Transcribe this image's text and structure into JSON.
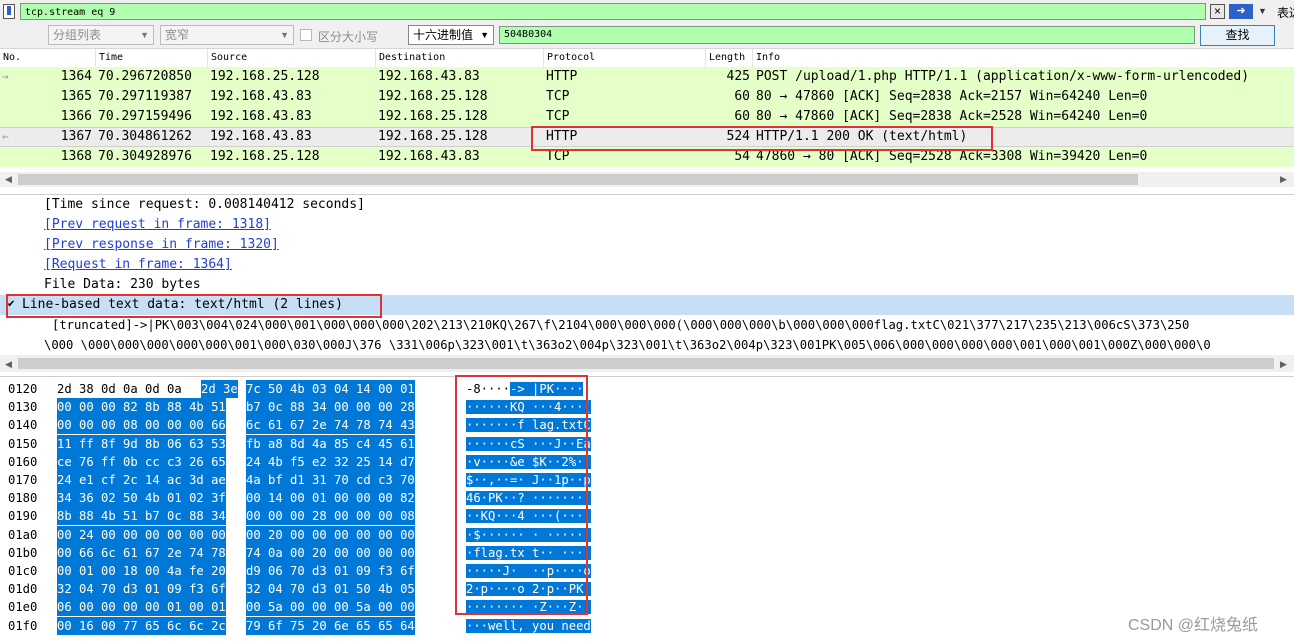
{
  "filter": {
    "value": "tcp.stream eq 9",
    "expression_label": "表达",
    "clear_icon": "x",
    "apply_icon": "arrow-right"
  },
  "find": {
    "display_combo": "分组列表",
    "charset_combo": "宽窄",
    "case_label": "区分大小写",
    "type_combo": "十六进制值",
    "search_value": "504B0304",
    "find_button": "查找"
  },
  "packet_list": {
    "columns": [
      "No.",
      "Time",
      "Source",
      "Destination",
      "Protocol",
      "Length",
      "Info"
    ],
    "rows": [
      {
        "no": "1364",
        "time": "70.296720850",
        "src": "192.168.25.128",
        "dst": "192.168.43.83",
        "proto": "HTTP",
        "len": "425",
        "info": "POST /upload/1.php HTTP/1.1  (application/x-www-form-urlencoded)",
        "rel": "→"
      },
      {
        "no": "1365",
        "time": "70.297119387",
        "src": "192.168.43.83",
        "dst": "192.168.25.128",
        "proto": "TCP",
        "len": "60",
        "info": "80 → 47860 [ACK] Seq=2838 Ack=2157 Win=64240 Len=0",
        "rel": ""
      },
      {
        "no": "1366",
        "time": "70.297159496",
        "src": "192.168.43.83",
        "dst": "192.168.25.128",
        "proto": "TCP",
        "len": "60",
        "info": "80 → 47860 [ACK] Seq=2838 Ack=2528 Win=64240 Len=0",
        "rel": ""
      },
      {
        "no": "1367",
        "time": "70.304861262",
        "src": "192.168.43.83",
        "dst": "192.168.25.128",
        "proto": "HTTP",
        "len": "524",
        "info": "HTTP/1.1 200 OK  (text/html)",
        "rel": "←"
      },
      {
        "no": "1368",
        "time": "70.304928976",
        "src": "192.168.25.128",
        "dst": "192.168.43.83",
        "proto": "TCP",
        "len": "54",
        "info": "47860 → 80 [ACK] Seq=2528 Ack=3308 Win=39420 Len=0",
        "rel": ""
      }
    ]
  },
  "details": {
    "time_since_request": "[Time since request: 0.008140412 seconds]",
    "prev_request": "[Prev request in frame: 1318]",
    "prev_response": "[Prev response in frame: 1320]",
    "request_in": "[Request in frame: 1364]",
    "file_data": "File Data: 230 bytes",
    "line_based": "Line-based text data: text/html (2 lines)",
    "truncated_line": "[truncated]->|PK\\003\\004\\024\\000\\001\\000\\000\\000\\202\\213\\210KQ\\267\\f\\2104\\000\\000\\000(\\000\\000\\000\\b\\000\\000\\000flag.txtC\\021\\377\\217\\235\\213\\006cS\\373\\250",
    "second_line": "\\000 \\000\\000\\000\\000\\000\\001\\000\\030\\000J\\376 \\331\\006p\\323\\001\\t\\363o2\\004p\\323\\001\\t\\363o2\\004p\\323\\001PK\\005\\006\\000\\000\\000\\000\\001\\000\\001\\000Z\\000\\000\\0"
  },
  "bytes": [
    {
      "off": "0120",
      "h1": "2d 38 0d 0a 0d 0a",
      "h2": "2d 3e",
      "h3": "7c 50 4b 03 04 14 00 01",
      "a1": "-8····",
      "a2": "->",
      "a3": " |PK····"
    },
    {
      "off": "0130",
      "h1": "",
      "h2": "00 00 00 82 8b 88 4b 51",
      "h3": "b7 0c 88 34 00 00 00 28",
      "a1": "",
      "a2": "······KQ",
      "a3": " ···4···("
    },
    {
      "off": "0140",
      "h1": "",
      "h2": "00 00 00 08 00 00 00 66",
      "h3": "6c 61 67 2e 74 78 74 43",
      "a1": "",
      "a2": "·······f",
      "a3": " lag.txtC"
    },
    {
      "off": "0150",
      "h1": "",
      "h2": "11 ff 8f 9d 8b 06 63 53",
      "h3": "fb a8 8d 4a 85 c4 45 61",
      "a1": "",
      "a2": "······cS",
      "a3": " ···J··Ea"
    },
    {
      "off": "0160",
      "h1": "",
      "h2": "ce 76 ff 0b cc c3 26 65",
      "h3": "24 4b f5 e2 32 25 14 d7",
      "a1": "",
      "a2": "·v····&e",
      "a3": " $K··2%··"
    },
    {
      "off": "0170",
      "h1": "",
      "h2": "24 e1 cf 2c 14 ac 3d ae",
      "h3": "4a bf d1 31 70 cd c3 70",
      "a1": "",
      "a2": "$··,··=·",
      "a3": " J··1p··p"
    },
    {
      "off": "0180",
      "h1": "",
      "h2": "34 36 02 50 4b 01 02 3f",
      "h3": "00 14 00 01 00 00 00 82",
      "a1": "",
      "a2": "46·PK··?",
      "a3": " ········"
    },
    {
      "off": "0190",
      "h1": "",
      "h2": "8b 88 4b 51 b7 0c 88 34",
      "h3": "00 00 00 28 00 00 00 08",
      "a1": "",
      "a2": "··KQ···4",
      "a3": " ···(····"
    },
    {
      "off": "01a0",
      "h1": "",
      "h2": "00 24 00 00 00 00 00 00",
      "h3": "00 20 00 00 00 00 00 00",
      "a1": "",
      "a2": "·$······",
      "a3": " · ······"
    },
    {
      "off": "01b0",
      "h1": "",
      "h2": "00 66 6c 61 67 2e 74 78",
      "h3": "74 0a 00 20 00 00 00 00",
      "a1": "",
      "a2": "·flag.tx",
      "a3": " t·· ····"
    },
    {
      "off": "01c0",
      "h1": "",
      "h2": "00 01 00 18 00 4a fe 20",
      "h3": "d9 06 70 d3 01 09 f3 6f",
      "a1": "",
      "a2": "·····J· ",
      "a3": " ··p····o"
    },
    {
      "off": "01d0",
      "h1": "",
      "h2": "32 04 70 d3 01 09 f3 6f",
      "h3": "32 04 70 d3 01 50 4b 05",
      "a1": "",
      "a2": "2·p····o",
      "a3": " 2·p··PK·"
    },
    {
      "off": "01e0",
      "h1": "",
      "h2": "06 00 00 00 00 01 00 01",
      "h3": "00 5a 00 00 00 5a 00 00",
      "a1": "",
      "a2": "········",
      "a3": " ·Z···Z··"
    },
    {
      "off": "01f0",
      "h1": "",
      "h2": "00 16 00 77 65 6c 6c 2c",
      "h3": "79 6f 75 20 6e 65 65 64",
      "a1": "",
      "a2": "···well,",
      "a3": " you need"
    }
  ],
  "watermark": "CSDN @红烧兔纸"
}
